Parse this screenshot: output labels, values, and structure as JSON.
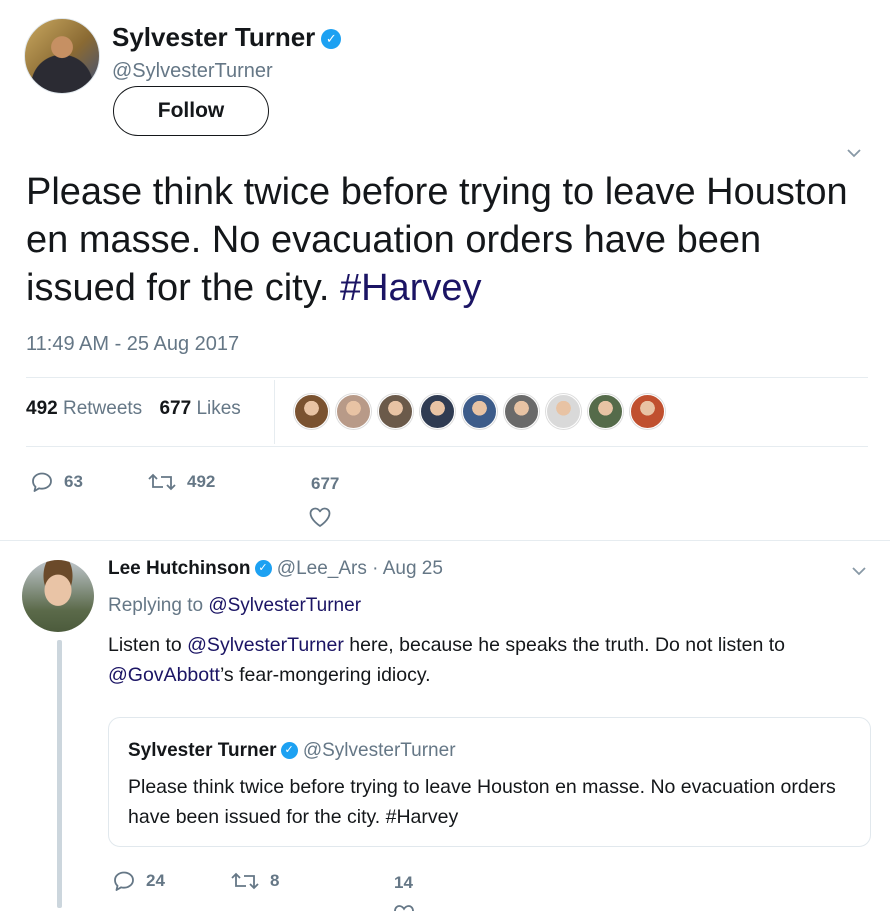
{
  "main_tweet": {
    "name": "Sylvester Turner",
    "handle": "@SylvesterTurner",
    "follow_label": "Follow",
    "text_before": "Please think twice before trying to leave Houston en masse. No evacuation orders have been issued for the city. ",
    "hashtag": "#Harvey",
    "timestamp": "11:49 AM - 25 Aug 2017",
    "retweets_count": "492",
    "retweets_label": "Retweets",
    "likes_count": "677",
    "likes_label": "Likes",
    "actions": {
      "reply": "63",
      "retweet": "492",
      "like": "677"
    }
  },
  "reply_tweet": {
    "name": "Lee Hutchinson",
    "handle": "@Lee_Ars",
    "date": "· Aug 25",
    "replying_prefix": "Replying to",
    "replying_to": "@SylvesterTurner",
    "text_1": "Listen to ",
    "mention_1": "@SylvesterTurner",
    "text_2": " here, because he speaks the truth. Do not listen to ",
    "mention_2": "@GovAbbott",
    "text_3": "’s fear-mongering idiocy.",
    "quote": {
      "name": "Sylvester Turner",
      "handle": "@SylvesterTurner",
      "text": "Please think twice before trying to leave Houston en masse. No evacuation orders have been issued for the city. #Harvey"
    },
    "actions": {
      "reply": "24",
      "retweet": "8",
      "like": "14"
    }
  },
  "colors": {
    "verified": "#1da1f2",
    "hashtag": "#1b1464",
    "muted": "#657786",
    "text": "#14171a",
    "divider": "#e6ecf0"
  },
  "liker_colors": [
    "#7a5230",
    "#b89a88",
    "#6b5a4a",
    "#2f3b52",
    "#3d5c8a",
    "#6a6a6a",
    "#d9d9d9",
    "#556b4a",
    "#c0502f"
  ]
}
